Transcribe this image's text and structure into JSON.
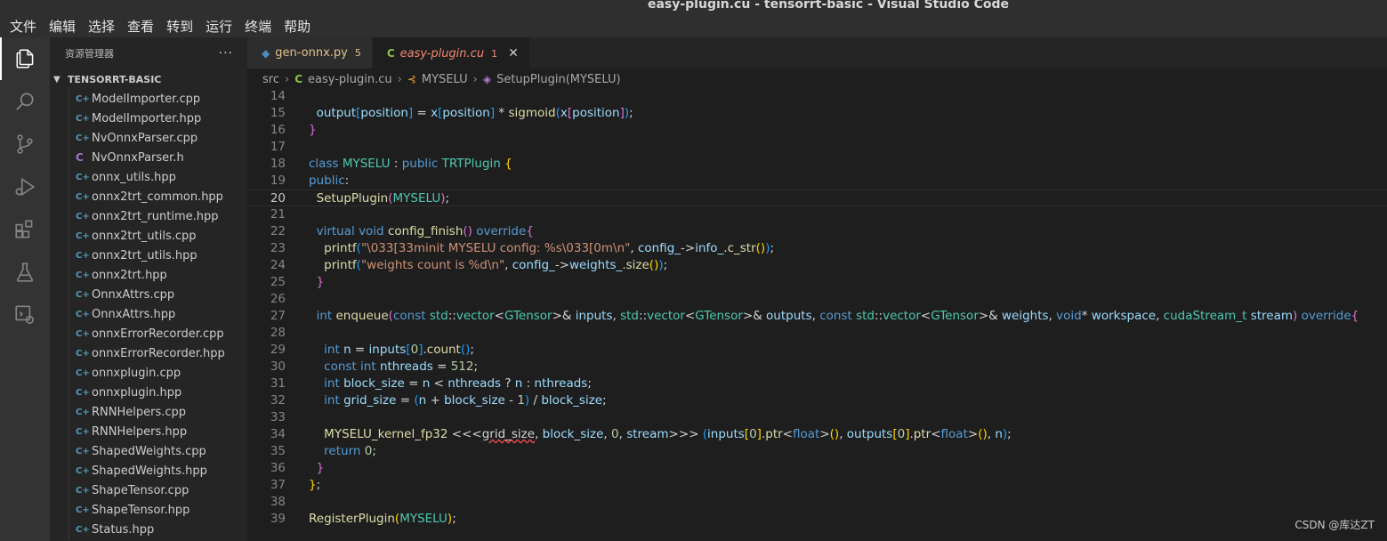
{
  "window": {
    "title": "easy-plugin.cu - tensorrt-basic - Visual Studio Code"
  },
  "menu": [
    "文件",
    "编辑",
    "选择",
    "查看",
    "转到",
    "运行",
    "终端",
    "帮助"
  ],
  "activity": [
    "files-icon",
    "search-icon",
    "source-control-icon",
    "run-debug-icon",
    "extensions-icon",
    "testing-icon",
    "remote-explorer-icon"
  ],
  "sidebar": {
    "title": "资源管理器",
    "more": "···",
    "folder": "TENSORRT-BASIC",
    "files": [
      {
        "name": "ModelImporter.cpp",
        "type": "cpp"
      },
      {
        "name": "ModelImporter.hpp",
        "type": "cpp"
      },
      {
        "name": "NvOnnxParser.cpp",
        "type": "cpp"
      },
      {
        "name": "NvOnnxParser.h",
        "type": "h"
      },
      {
        "name": "onnx_utils.hpp",
        "type": "cpp"
      },
      {
        "name": "onnx2trt_common.hpp",
        "type": "cpp"
      },
      {
        "name": "onnx2trt_runtime.hpp",
        "type": "cpp"
      },
      {
        "name": "onnx2trt_utils.cpp",
        "type": "cpp"
      },
      {
        "name": "onnx2trt_utils.hpp",
        "type": "cpp"
      },
      {
        "name": "onnx2trt.hpp",
        "type": "cpp"
      },
      {
        "name": "OnnxAttrs.cpp",
        "type": "cpp"
      },
      {
        "name": "OnnxAttrs.hpp",
        "type": "cpp"
      },
      {
        "name": "onnxErrorRecorder.cpp",
        "type": "cpp"
      },
      {
        "name": "onnxErrorRecorder.hpp",
        "type": "cpp"
      },
      {
        "name": "onnxplugin.cpp",
        "type": "cpp"
      },
      {
        "name": "onnxplugin.hpp",
        "type": "cpp"
      },
      {
        "name": "RNNHelpers.cpp",
        "type": "cpp"
      },
      {
        "name": "RNNHelpers.hpp",
        "type": "cpp"
      },
      {
        "name": "ShapedWeights.cpp",
        "type": "cpp"
      },
      {
        "name": "ShapedWeights.hpp",
        "type": "cpp"
      },
      {
        "name": "ShapeTensor.cpp",
        "type": "cpp"
      },
      {
        "name": "ShapeTensor.hpp",
        "type": "cpp"
      },
      {
        "name": "Status.hpp",
        "type": "cpp"
      }
    ]
  },
  "tabs": [
    {
      "name": "gen-onnx.py",
      "badge": "5",
      "icon": "python-icon",
      "glyph": "◆",
      "glyph_color": "#4b8bbe",
      "active": false,
      "badge_color": "#e2c08d"
    },
    {
      "name": "easy-plugin.cu",
      "badge": "1",
      "icon": "cuda-file-icon",
      "glyph": "C",
      "glyph_color": "#8bc34a",
      "active": true,
      "badge_color": "#f48771",
      "close": "✕"
    }
  ],
  "breadcrumb": [
    "src",
    "easy-plugin.cu",
    "MYSELU",
    "SetupPlugin(MYSELU)"
  ],
  "editor": {
    "current_line": 20,
    "lines": [
      {
        "n": 14,
        "tokens": []
      },
      {
        "n": 15,
        "tokens": [
          [
            "",
            "  "
          ],
          [
            "var",
            "output"
          ],
          [
            "br3",
            "["
          ],
          [
            "var",
            "position"
          ],
          [
            "br3",
            "]"
          ],
          [
            "",
            " = "
          ],
          [
            "var",
            "x"
          ],
          [
            "br3",
            "["
          ],
          [
            "var",
            "position"
          ],
          [
            "br3",
            "]"
          ],
          [
            "",
            " * "
          ],
          [
            "fn",
            "sigmoid"
          ],
          [
            "br3",
            "("
          ],
          [
            "var",
            "x"
          ],
          [
            "br2",
            "["
          ],
          [
            "var",
            "position"
          ],
          [
            "br2",
            "]"
          ],
          [
            "br3",
            ")"
          ],
          [
            "",
            ";"
          ]
        ]
      },
      {
        "n": 16,
        "tokens": [
          [
            "br2",
            "}"
          ]
        ]
      },
      {
        "n": 17,
        "tokens": []
      },
      {
        "n": 18,
        "tokens": [
          [
            "kw",
            "class"
          ],
          [
            "",
            " "
          ],
          [
            "ty",
            "MYSELU"
          ],
          [
            "",
            " : "
          ],
          [
            "kw",
            "public"
          ],
          [
            "",
            " "
          ],
          [
            "ty",
            "TRTPlugin"
          ],
          [
            "",
            " "
          ],
          [
            "br1",
            "{"
          ]
        ]
      },
      {
        "n": 19,
        "tokens": [
          [
            "kw",
            "public"
          ],
          [
            "",
            ":"
          ]
        ]
      },
      {
        "n": 20,
        "tokens": [
          [
            "",
            "  "
          ],
          [
            "fn",
            "SetupPlugin"
          ],
          [
            "br2",
            "("
          ],
          [
            "ty",
            "MYSELU"
          ],
          [
            "br2",
            ")"
          ],
          [
            "",
            ";"
          ]
        ]
      },
      {
        "n": 21,
        "tokens": []
      },
      {
        "n": 22,
        "tokens": [
          [
            "",
            "  "
          ],
          [
            "kw",
            "virtual"
          ],
          [
            "",
            " "
          ],
          [
            "kw",
            "void"
          ],
          [
            "",
            " "
          ],
          [
            "fn",
            "config_finish"
          ],
          [
            "br2",
            "()"
          ],
          [
            "",
            " "
          ],
          [
            "kw",
            "override"
          ],
          [
            "br2",
            "{"
          ]
        ]
      },
      {
        "n": 23,
        "tokens": [
          [
            "",
            "    "
          ],
          [
            "fn",
            "printf"
          ],
          [
            "br3",
            "("
          ],
          [
            "str",
            "\"\\033[33minit MYSELU config: %s\\033[0m\\n\""
          ],
          [
            "",
            ", "
          ],
          [
            "var",
            "config_"
          ],
          [
            "",
            "->"
          ],
          [
            "var",
            "info_"
          ],
          [
            "",
            "."
          ],
          [
            "fn",
            "c_str"
          ],
          [
            "br1",
            "()"
          ],
          [
            "br3",
            ")"
          ],
          [
            "",
            ";"
          ]
        ]
      },
      {
        "n": 24,
        "tokens": [
          [
            "",
            "    "
          ],
          [
            "fn",
            "printf"
          ],
          [
            "br3",
            "("
          ],
          [
            "str",
            "\"weights count is %d\\n\""
          ],
          [
            "",
            ", "
          ],
          [
            "var",
            "config_"
          ],
          [
            "",
            "->"
          ],
          [
            "var",
            "weights_"
          ],
          [
            "",
            "."
          ],
          [
            "fn",
            "size"
          ],
          [
            "br1",
            "()"
          ],
          [
            "br3",
            ")"
          ],
          [
            "",
            ";"
          ]
        ]
      },
      {
        "n": 25,
        "tokens": [
          [
            "",
            "  "
          ],
          [
            "br2",
            "}"
          ]
        ]
      },
      {
        "n": 26,
        "tokens": []
      },
      {
        "n": 27,
        "tokens": [
          [
            "",
            "  "
          ],
          [
            "kw",
            "int"
          ],
          [
            "",
            " "
          ],
          [
            "fn",
            "enqueue"
          ],
          [
            "br2",
            "("
          ],
          [
            "kw",
            "const"
          ],
          [
            "",
            " "
          ],
          [
            "ty",
            "std"
          ],
          [
            "",
            "::"
          ],
          [
            "ty",
            "vector"
          ],
          [
            "",
            "<"
          ],
          [
            "ty",
            "GTensor"
          ],
          [
            "",
            ">& "
          ],
          [
            "var",
            "inputs"
          ],
          [
            "",
            ", "
          ],
          [
            "ty",
            "std"
          ],
          [
            "",
            "::"
          ],
          [
            "ty",
            "vector"
          ],
          [
            "",
            "<"
          ],
          [
            "ty",
            "GTensor"
          ],
          [
            "",
            ">& "
          ],
          [
            "var",
            "outputs"
          ],
          [
            "",
            ", "
          ],
          [
            "kw",
            "const"
          ],
          [
            "",
            " "
          ],
          [
            "ty",
            "std"
          ],
          [
            "",
            "::"
          ],
          [
            "ty",
            "vector"
          ],
          [
            "",
            "<"
          ],
          [
            "ty",
            "GTensor"
          ],
          [
            "",
            ">& "
          ],
          [
            "var",
            "weights"
          ],
          [
            "",
            ", "
          ],
          [
            "kw",
            "void"
          ],
          [
            "",
            "* "
          ],
          [
            "var",
            "workspace"
          ],
          [
            "",
            ", "
          ],
          [
            "ty",
            "cudaStream_t"
          ],
          [
            "",
            " "
          ],
          [
            "var",
            "stream"
          ],
          [
            "br2",
            ")"
          ],
          [
            "",
            " "
          ],
          [
            "kw",
            "override"
          ],
          [
            "br2",
            "{"
          ]
        ]
      },
      {
        "n": 28,
        "tokens": []
      },
      {
        "n": 29,
        "tokens": [
          [
            "",
            "    "
          ],
          [
            "kw",
            "int"
          ],
          [
            "",
            " "
          ],
          [
            "var",
            "n"
          ],
          [
            "",
            " = "
          ],
          [
            "var",
            "inputs"
          ],
          [
            "br3",
            "["
          ],
          [
            "num",
            "0"
          ],
          [
            "br3",
            "]"
          ],
          [
            "",
            "."
          ],
          [
            "fn",
            "count"
          ],
          [
            "br3",
            "()"
          ],
          [
            "",
            ";"
          ]
        ]
      },
      {
        "n": 30,
        "tokens": [
          [
            "",
            "    "
          ],
          [
            "kw",
            "const"
          ],
          [
            "",
            " "
          ],
          [
            "kw",
            "int"
          ],
          [
            "",
            " "
          ],
          [
            "var",
            "nthreads"
          ],
          [
            "",
            " = "
          ],
          [
            "num",
            "512"
          ],
          [
            "",
            ";"
          ]
        ]
      },
      {
        "n": 31,
        "tokens": [
          [
            "",
            "    "
          ],
          [
            "kw",
            "int"
          ],
          [
            "",
            " "
          ],
          [
            "var",
            "block_size"
          ],
          [
            "",
            " = "
          ],
          [
            "var",
            "n"
          ],
          [
            "",
            " < "
          ],
          [
            "var",
            "nthreads"
          ],
          [
            "",
            " ? "
          ],
          [
            "var",
            "n"
          ],
          [
            "",
            " : "
          ],
          [
            "var",
            "nthreads"
          ],
          [
            "",
            ";"
          ]
        ]
      },
      {
        "n": 32,
        "tokens": [
          [
            "",
            "    "
          ],
          [
            "kw",
            "int"
          ],
          [
            "",
            " "
          ],
          [
            "var",
            "grid_size"
          ],
          [
            "",
            " = "
          ],
          [
            "br3",
            "("
          ],
          [
            "var",
            "n"
          ],
          [
            "",
            " + "
          ],
          [
            "var",
            "block_size"
          ],
          [
            "",
            " - "
          ],
          [
            "num",
            "1"
          ],
          [
            "br3",
            ")"
          ],
          [
            "",
            " / "
          ],
          [
            "var",
            "block_size"
          ],
          [
            "",
            ";"
          ]
        ]
      },
      {
        "n": 33,
        "tokens": []
      },
      {
        "n": 34,
        "tokens": [
          [
            "",
            "    "
          ],
          [
            "fn",
            "MYSELU_kernel_fp32"
          ],
          [
            "",
            " <<<"
          ],
          [
            "sq",
            "grid_size"
          ],
          [
            "",
            ", "
          ],
          [
            "var",
            "block_size"
          ],
          [
            "",
            ", "
          ],
          [
            "num",
            "0"
          ],
          [
            "",
            ", "
          ],
          [
            "var",
            "stream"
          ],
          [
            "",
            ">>> "
          ],
          [
            "br3",
            "("
          ],
          [
            "var",
            "inputs"
          ],
          [
            "br1",
            "["
          ],
          [
            "num",
            "0"
          ],
          [
            "br1",
            "]"
          ],
          [
            "",
            "."
          ],
          [
            "fn",
            "ptr"
          ],
          [
            "",
            "<"
          ],
          [
            "kw",
            "float"
          ],
          [
            "",
            ">"
          ],
          [
            "br1",
            "()"
          ],
          [
            "",
            ", "
          ],
          [
            "var",
            "outputs"
          ],
          [
            "br1",
            "["
          ],
          [
            "num",
            "0"
          ],
          [
            "br1",
            "]"
          ],
          [
            "",
            "."
          ],
          [
            "fn",
            "ptr"
          ],
          [
            "",
            "<"
          ],
          [
            "kw",
            "float"
          ],
          [
            "",
            ">"
          ],
          [
            "br1",
            "()"
          ],
          [
            "",
            ", "
          ],
          [
            "var",
            "n"
          ],
          [
            "br3",
            ")"
          ],
          [
            "",
            ";"
          ]
        ]
      },
      {
        "n": 35,
        "tokens": [
          [
            "",
            "    "
          ],
          [
            "kw",
            "return"
          ],
          [
            "",
            " "
          ],
          [
            "num",
            "0"
          ],
          [
            "",
            ";"
          ]
        ]
      },
      {
        "n": 36,
        "tokens": [
          [
            "",
            "  "
          ],
          [
            "br2",
            "}"
          ]
        ]
      },
      {
        "n": 37,
        "tokens": [
          [
            "br1",
            "}"
          ],
          [
            "",
            ";"
          ]
        ]
      },
      {
        "n": 38,
        "tokens": []
      },
      {
        "n": 39,
        "tokens": [
          [
            "fn",
            "RegisterPlugin"
          ],
          [
            "br1",
            "("
          ],
          [
            "ty",
            "MYSELU"
          ],
          [
            "br1",
            ")"
          ],
          [
            "",
            ";"
          ]
        ]
      }
    ]
  },
  "watermark": "CSDN @库达ZT"
}
